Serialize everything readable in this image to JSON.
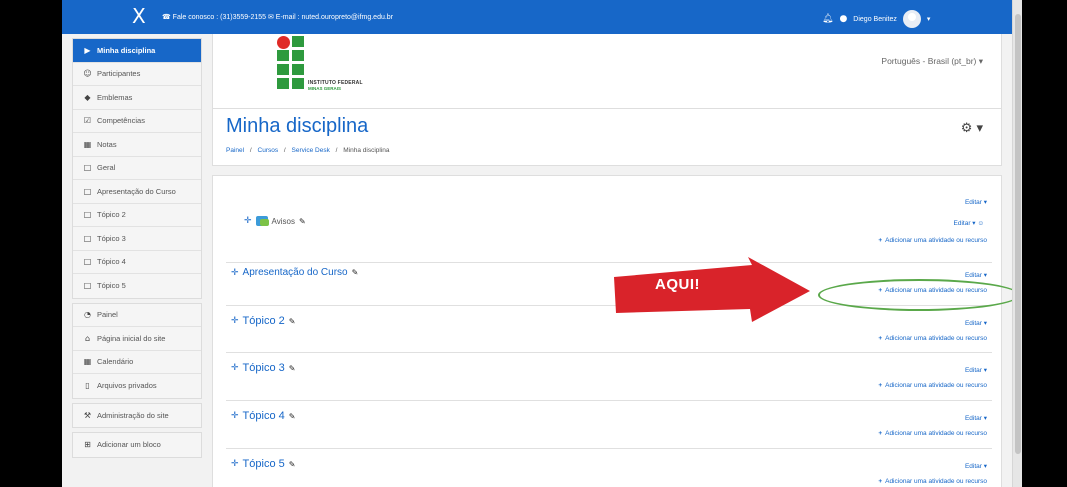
{
  "navbar": {
    "close_glyph": "X",
    "contact": "☎ Fale conosco : (31)3559-2155 ✉ E-mail : nuted.ouropreto@ifmg.edu.br",
    "user_name": "Diego Benitez",
    "caret": "▾"
  },
  "sidebar": {
    "group1": [
      {
        "label": "Minha disciplina",
        "icon": "graduation-cap-icon",
        "glyph": "▶"
      },
      {
        "label": "Participantes",
        "icon": "users-icon",
        "glyph": "☺"
      },
      {
        "label": "Emblemas",
        "icon": "shield-icon",
        "glyph": "◆"
      },
      {
        "label": "Competências",
        "icon": "checkbox-icon",
        "glyph": "☑"
      },
      {
        "label": "Notas",
        "icon": "table-icon",
        "glyph": "▦"
      },
      {
        "label": "Geral",
        "icon": "folder-icon",
        "glyph": "□"
      },
      {
        "label": "Apresentação do Curso",
        "icon": "folder-icon",
        "glyph": "□"
      },
      {
        "label": "Tópico 2",
        "icon": "folder-icon",
        "glyph": "□"
      },
      {
        "label": "Tópico 3",
        "icon": "folder-icon",
        "glyph": "□"
      },
      {
        "label": "Tópico 4",
        "icon": "folder-icon",
        "glyph": "□"
      },
      {
        "label": "Tópico 5",
        "icon": "folder-icon",
        "glyph": "□"
      }
    ],
    "group2": [
      {
        "label": "Painel",
        "icon": "dashboard-icon",
        "glyph": "◔"
      },
      {
        "label": "Página inicial do site",
        "icon": "home-icon",
        "glyph": "⌂"
      },
      {
        "label": "Calendário",
        "icon": "calendar-icon",
        "glyph": "▦"
      },
      {
        "label": "Arquivos privados",
        "icon": "file-icon",
        "glyph": "▯"
      }
    ],
    "group3": [
      {
        "label": "Administração do site",
        "icon": "wrench-icon",
        "glyph": "⚒"
      }
    ],
    "group4": [
      {
        "label": "Adicionar um bloco",
        "icon": "plus-square-icon",
        "glyph": "⊞"
      }
    ]
  },
  "logo": {
    "line1": "INSTITUTO FEDERAL",
    "line2": "MINAS GERAIS"
  },
  "language": "Português - Brasil (pt_br) ▾",
  "header": {
    "title": "Minha disciplina",
    "breadcrumb": [
      "Painel",
      "Cursos",
      "Service Desk",
      "Minha disciplina"
    ],
    "sep": "/",
    "gear": "⚙ ▾"
  },
  "sections": {
    "add_activity": "Adicionar uma atividade ou recurso",
    "editar": "Editar ▾",
    "plus": "+",
    "move": "✛",
    "pencil": "✎",
    "avisos": "Avisos",
    "editar_person": "Editar ▾ ☺",
    "titles": [
      "Apresentação do Curso",
      "Tópico 2",
      "Tópico 3",
      "Tópico 4",
      "Tópico 5"
    ]
  },
  "annotation": {
    "label": "AQUI!",
    "arrow_color": "#d9232a",
    "oval_color": "#5aa84a"
  },
  "colors": {
    "brand_blue": "#1767c8",
    "ifmg_green": "#2e9a3e",
    "ifmg_red": "#e02a26"
  }
}
